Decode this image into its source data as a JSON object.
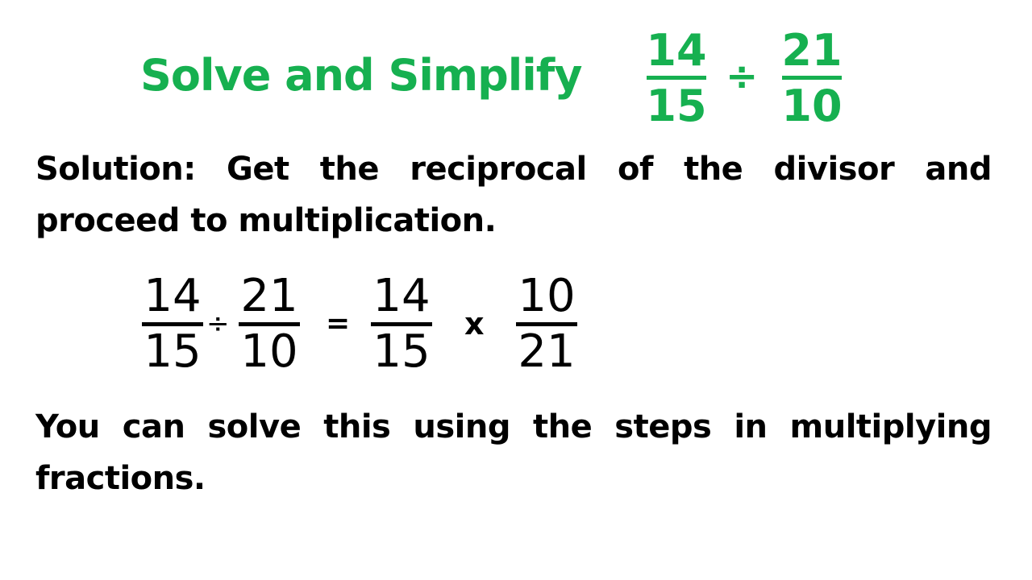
{
  "colors": {
    "accent": "#16B050",
    "text": "#000000",
    "background": "#FFFFFF"
  },
  "title": {
    "text": "Solve and Simplify",
    "problem": {
      "fraction1": {
        "numerator": "14",
        "denominator": "15"
      },
      "operator": "÷",
      "fraction2": {
        "numerator": "21",
        "denominator": "10"
      }
    }
  },
  "solution_text": "Solution: Get the reciprocal of the divisor and proceed to multiplication.",
  "equation": {
    "left_fraction1": {
      "numerator": "14",
      "denominator": "15"
    },
    "left_operator": "÷",
    "left_fraction2": {
      "numerator": "21",
      "denominator": "10"
    },
    "equals": "=",
    "right_fraction1": {
      "numerator": "14",
      "denominator": "15"
    },
    "right_operator": "x",
    "right_fraction2": {
      "numerator": "10",
      "denominator": "21"
    }
  },
  "note_text": "You can solve this using the steps in multiplying fractions."
}
